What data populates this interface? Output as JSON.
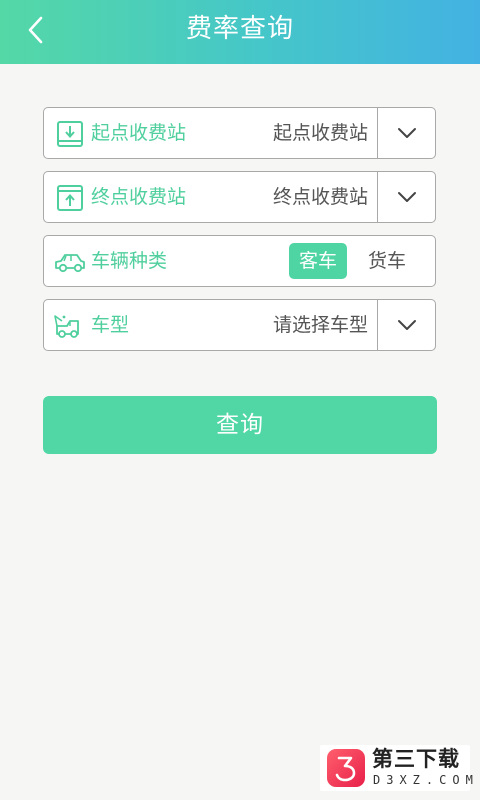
{
  "header": {
    "title": "费率查询",
    "back_icon": "chevron-left-icon"
  },
  "form": {
    "start_station": {
      "label": "起点收费站",
      "value": "起点收费站",
      "icon": "download-box-icon"
    },
    "end_station": {
      "label": "终点收费站",
      "value": "终点收费站",
      "icon": "upload-box-icon"
    },
    "vehicle_category": {
      "label": "车辆种类",
      "icon": "car-icon",
      "options": [
        "客车",
        "货车"
      ],
      "selected": "客车"
    },
    "vehicle_type": {
      "label": "车型",
      "value": "请选择车型",
      "icon": "tow-truck-icon"
    }
  },
  "query_button": {
    "label": "查询"
  },
  "watermark": {
    "title": "第三下载",
    "subtitle": "D3XZ.COM"
  },
  "colors": {
    "accent": "#4fd4a3",
    "header_gradient_start": "#54d8a6",
    "header_gradient_end": "#43b2e3",
    "border": "#a9a9a9",
    "background": "#f6f6f4"
  }
}
